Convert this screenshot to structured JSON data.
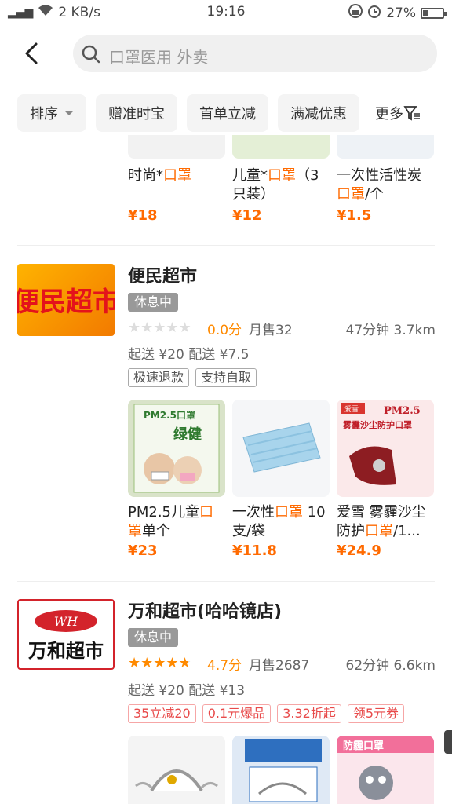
{
  "status": {
    "signal": "⋮▐",
    "speed": "2 KB/s",
    "time": "19:16",
    "battery": "27%",
    "battery_level": 0.27
  },
  "search": {
    "placeholder": "口罩医用 外卖"
  },
  "filters": [
    "排序",
    "赠准时宝",
    "首单立减",
    "满减优惠",
    "更多"
  ],
  "partial_products": [
    {
      "name_pre": "时尚*",
      "name_hl": "口罩",
      "name_post": "",
      "price": "¥18"
    },
    {
      "name_pre": "儿童*",
      "name_hl": "口罩",
      "name_post": "（3只装）",
      "price": "¥12"
    },
    {
      "name_pre": "一次性活性炭",
      "name_hl": "口罩",
      "name_post": "/个",
      "price": "¥1.5"
    }
  ],
  "stores": [
    {
      "logo_text": "便民超市",
      "name": "便民超市",
      "status": "休息中",
      "rating": 0.0,
      "score": "0.0分",
      "sales": "月售32",
      "distance": "47分钟  3.7km",
      "fee": "起送 ¥20   配送 ¥7.5",
      "tags": [
        "极速退款",
        "支持自取"
      ],
      "products": [
        {
          "img_label": "PM2.5口罩 绿健",
          "name_pre": "PM2.5儿童",
          "name_hl": "口罩",
          "name_post": "单个",
          "price": "¥23"
        },
        {
          "img_label": "",
          "name_pre": "一次性",
          "name_hl": "口罩",
          "name_post": " 10支/袋",
          "price": "¥11.8"
        },
        {
          "img_label": "爱雪 PM2.5 雾霾沙尘防护口罩",
          "name_pre": "爱雪 雾霾沙尘防护",
          "name_hl": "口罩",
          "name_post": "/1...",
          "price": "¥24.9"
        }
      ]
    },
    {
      "logo_text": "万和超市",
      "logo_mark": "WH",
      "name": "万和超市(哈哈镜店)",
      "status": "休息中",
      "rating": 4.7,
      "score": "4.7分",
      "sales": "月售2687",
      "distance": "62分钟  6.6km",
      "fee": "起送 ¥20   配送 ¥13",
      "tags": [
        "35立减20",
        "0.1元爆品",
        "3.32折起",
        "领5元券"
      ]
    }
  ],
  "colors": {
    "accent": "#ff6a00",
    "badge": "#999999",
    "logo_red": "#e4131b"
  }
}
